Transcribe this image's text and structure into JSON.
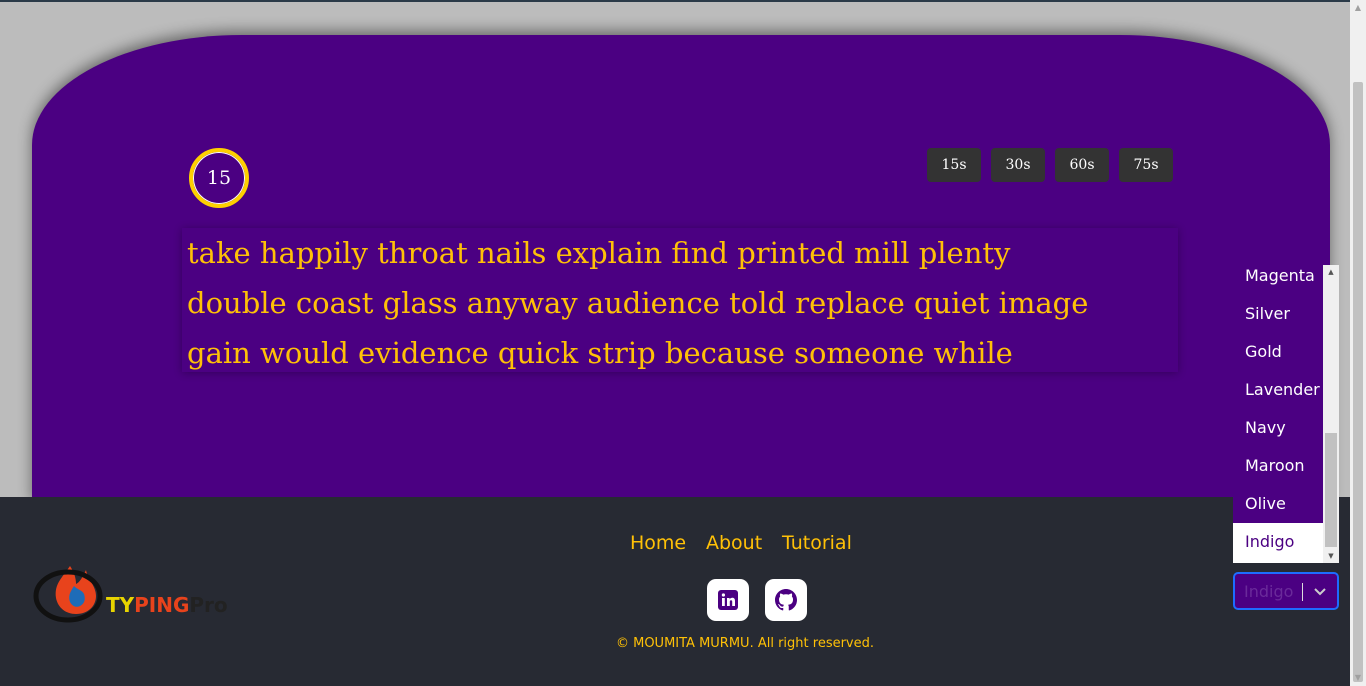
{
  "timer": {
    "value": "15"
  },
  "time_options": [
    "15s",
    "30s",
    "60s",
    "75s"
  ],
  "typing_words": [
    "take happily throat nails explain find printed mill plenty",
    "double coast glass anyway audience told replace quiet image",
    "gain would evidence quick strip because someone while"
  ],
  "footer": {
    "logo_text": "TYPINGPRO",
    "nav": [
      "Home",
      "About",
      "Tutorial"
    ],
    "copyright": "© MOUMITA MURMU. All right reserved."
  },
  "theme_select": {
    "value": "Indigo",
    "visible_options": [
      "Magenta",
      "Silver",
      "Gold",
      "Lavender",
      "Navy",
      "Maroon",
      "Olive",
      "Indigo"
    ]
  },
  "colors": {
    "theme": "#4b0082",
    "accent": "#ffc107",
    "footer": "#272a33"
  },
  "icons": [
    "linkedin-icon",
    "github-icon",
    "chevron-down-icon"
  ]
}
